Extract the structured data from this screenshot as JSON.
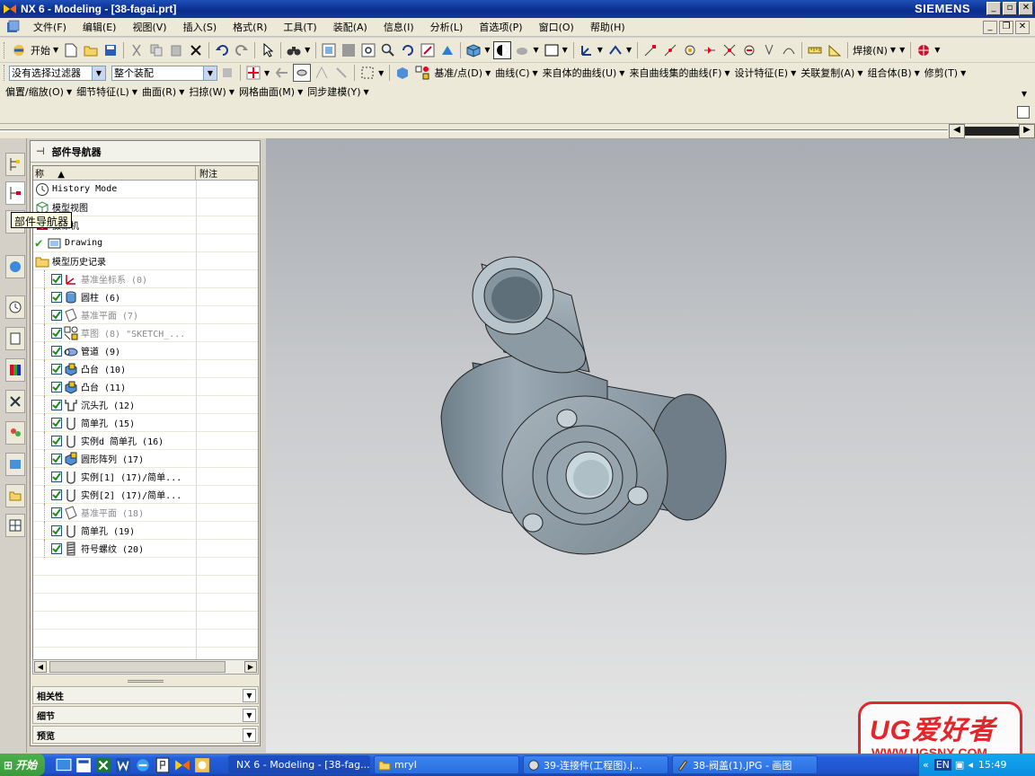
{
  "window": {
    "title": "NX 6 - Modeling - [38-fagai.prt]",
    "brand": "SIEMENS",
    "min": "_",
    "max": "▫",
    "close": "✕"
  },
  "menu": {
    "items": [
      "文件(F)",
      "编辑(E)",
      "视图(V)",
      "插入(S)",
      "格式(R)",
      "工具(T)",
      "装配(A)",
      "信息(I)",
      "分析(L)",
      "首选项(P)",
      "窗口(O)",
      "帮助(H)"
    ]
  },
  "toolbar1": {
    "start_label": "开始"
  },
  "toolbar2": {
    "filter_value": "没有选择过滤器",
    "scope_value": "整个装配",
    "labels": [
      "基准/点(D)",
      "曲线(C)",
      "来自体的曲线(U)",
      "来自曲线集的曲线(F)",
      "设计特征(E)",
      "关联复制(A)",
      "组合体(B)",
      "修剪(T)"
    ]
  },
  "toolbar3": {
    "labels": [
      "偏置/缩放(O)",
      "细节特征(L)",
      "曲面(R)",
      "扫掠(W)",
      "网格曲面(M)",
      "同步建模(Y)"
    ],
    "weld_label": "焊接(N)"
  },
  "navigator": {
    "title": "部件导航器",
    "col_name": "称",
    "col_note": "附注",
    "tooltip": "部件导航器",
    "top_rows": [
      {
        "label": "History Mode",
        "icon": "clock-icon"
      },
      {
        "label": "模型视图",
        "icon": "view-cube-icon"
      },
      {
        "label": "摄像机",
        "icon": "camera-icon"
      },
      {
        "label": "Drawing",
        "icon": "drawing-icon"
      },
      {
        "label": "模型历史记录",
        "icon": "folder-icon"
      }
    ],
    "features": [
      {
        "label": "基准坐标系 (0)",
        "grey": true,
        "icon": "csys-icon"
      },
      {
        "label": "圆柱 (6)",
        "grey": false,
        "icon": "cylinder-icon"
      },
      {
        "label": "基准平面 (7)",
        "grey": true,
        "icon": "plane-icon"
      },
      {
        "label": "草图 (8) \"SKETCH_...",
        "grey": true,
        "icon": "sketch-icon"
      },
      {
        "label": "管道 (9)",
        "grey": false,
        "icon": "tube-icon"
      },
      {
        "label": "凸台 (10)",
        "grey": false,
        "icon": "boss-icon"
      },
      {
        "label": "凸台 (11)",
        "grey": false,
        "icon": "boss-icon"
      },
      {
        "label": "沉头孔 (12)",
        "grey": false,
        "icon": "counterbore-hole-icon"
      },
      {
        "label": "简单孔 (15)",
        "grey": false,
        "icon": "simple-hole-icon"
      },
      {
        "label": "实例d 简单孔 (16)",
        "grey": false,
        "icon": "simple-hole-icon"
      },
      {
        "label": "圆形阵列 (17)",
        "grey": false,
        "icon": "circular-array-icon"
      },
      {
        "label": "实例[1] (17)/简单...",
        "grey": false,
        "icon": "simple-hole-icon"
      },
      {
        "label": "实例[2] (17)/简单...",
        "grey": false,
        "icon": "simple-hole-icon"
      },
      {
        "label": "基准平面 (18)",
        "grey": true,
        "icon": "plane-icon"
      },
      {
        "label": "简单孔 (19)",
        "grey": false,
        "icon": "simple-hole-icon"
      },
      {
        "label": "符号螺纹 (20)",
        "grey": false,
        "icon": "thread-icon"
      }
    ],
    "sections": [
      "相关性",
      "细节",
      "预览"
    ]
  },
  "taskbar": {
    "start": "开始",
    "tasks": [
      {
        "label": "NX 6 - Modeling - [38-fag...",
        "active": true
      },
      {
        "label": "mryl",
        "active": false
      },
      {
        "label": "39-连接件(工程图).j...",
        "active": false
      },
      {
        "label": "38-阀盖(1).JPG - 画图",
        "active": false
      }
    ],
    "tray_lang": "EN",
    "clock": "15:49"
  },
  "watermark": {
    "big": "UG爱好者",
    "small": "WWW.UGSNX.COM"
  },
  "colors": {
    "titlebar": "#0a2c8a",
    "part_body": "#8f9ea8",
    "watermark_red": "#e2262a"
  }
}
